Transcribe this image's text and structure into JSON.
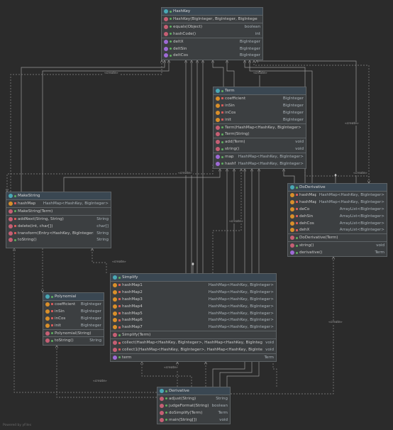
{
  "diagram": {
    "classes": [
      {
        "key": "hashkey",
        "name": "HashKey",
        "sections": [
          [
            {
              "icon": "method",
              "vis": "public",
              "name": "HashKey(BigInteger, BigInteger, BigInteger)",
              "type": ""
            }
          ],
          [
            {
              "icon": "method",
              "vis": "public",
              "name": "equals(Object)",
              "type": "boolean"
            },
            {
              "icon": "method",
              "vis": "public",
              "name": "hashCode()",
              "type": "int"
            }
          ],
          [
            {
              "icon": "property",
              "vis": "public",
              "name": "deltX",
              "type": "BigInteger"
            },
            {
              "icon": "property",
              "vis": "public",
              "name": "deltSin",
              "type": "BigInteger"
            },
            {
              "icon": "property",
              "vis": "public",
              "name": "deltCos",
              "type": "BigInteger"
            }
          ]
        ]
      },
      {
        "key": "term",
        "name": "Term",
        "sections": [
          [
            {
              "icon": "field",
              "vis": "private",
              "name": "coefficient",
              "type": "BigInteger"
            },
            {
              "icon": "field",
              "vis": "private",
              "name": "inSin",
              "type": "BigInteger"
            },
            {
              "icon": "field",
              "vis": "private",
              "name": "inCos",
              "type": "BigInteger"
            },
            {
              "icon": "field",
              "vis": "private",
              "name": "init",
              "type": "BigInteger"
            }
          ],
          [
            {
              "icon": "method",
              "vis": "public",
              "name": "Term(HashMap<HashKey, BigInteger>)",
              "type": ""
            },
            {
              "icon": "method",
              "vis": "public",
              "name": "Term(String)",
              "type": ""
            }
          ],
          [
            {
              "icon": "method",
              "vis": "public",
              "name": "add(Term)",
              "type": "void"
            },
            {
              "icon": "method",
              "vis": "public",
              "name": "string()",
              "type": "void"
            }
          ],
          [
            {
              "icon": "property",
              "vis": "public",
              "name": "map",
              "type": "HashMap<HashKey, BigInteger>"
            },
            {
              "icon": "property",
              "vis": "public",
              "name": "hashMap",
              "type": "HashMap<HashKey, BigInteger>"
            }
          ]
        ]
      },
      {
        "key": "makestring",
        "name": "MakeString",
        "sections": [
          [
            {
              "icon": "field",
              "vis": "private",
              "name": "hashMap",
              "type": "HashMap<HashKey, BigInteger>"
            }
          ],
          [
            {
              "icon": "method",
              "vis": "public",
              "name": "MakeString(Term)",
              "type": ""
            }
          ],
          [
            {
              "icon": "method",
              "vis": "private",
              "name": "addNext(String, String)",
              "type": "String"
            },
            {
              "icon": "method",
              "vis": "private",
              "name": "delete(int, char[])",
              "type": "char[]"
            },
            {
              "icon": "method",
              "vis": "private",
              "name": "transform(Entry<HashKey, BigInteger>)",
              "type": "String"
            },
            {
              "icon": "method",
              "vis": "public",
              "name": "toString()",
              "type": "String"
            }
          ]
        ]
      },
      {
        "key": "doderivative",
        "name": "DoDerivative",
        "sections": [
          [
            {
              "icon": "field",
              "vis": "private",
              "name": "hashMap1",
              "type": "HashMap<HashKey, BigInteger>"
            },
            {
              "icon": "field",
              "vis": "private",
              "name": "hashMap2",
              "type": "HashMap<HashKey, BigInteger>"
            },
            {
              "icon": "field",
              "vis": "private",
              "name": "deCo",
              "type": "ArrayList<BigInteger>"
            },
            {
              "icon": "field",
              "vis": "private",
              "name": "dehSin",
              "type": "ArrayList<BigInteger>"
            },
            {
              "icon": "field",
              "vis": "private",
              "name": "dehCos",
              "type": "ArrayList<BigInteger>"
            },
            {
              "icon": "field",
              "vis": "private",
              "name": "dehX",
              "type": "ArrayList<BigInteger>"
            }
          ],
          [
            {
              "icon": "method",
              "vis": "public",
              "name": "DoDerivative(Term)",
              "type": ""
            }
          ],
          [
            {
              "icon": "method",
              "vis": "public",
              "name": "string()",
              "type": "void"
            },
            {
              "icon": "property",
              "vis": "public",
              "name": "derivative()",
              "type": "Term"
            }
          ]
        ]
      },
      {
        "key": "simplify",
        "name": "Simplify",
        "sections": [
          [
            {
              "icon": "field",
              "vis": "private",
              "name": "hashMap1",
              "type": "HashMap<HashKey, BigInteger>"
            },
            {
              "icon": "field",
              "vis": "private",
              "name": "hashMap2",
              "type": "HashMap<HashKey, BigInteger>"
            },
            {
              "icon": "field",
              "vis": "private",
              "name": "hashMap3",
              "type": "HashMap<HashKey, BigInteger>"
            },
            {
              "icon": "field",
              "vis": "private",
              "name": "hashMap4",
              "type": "HashMap<HashKey, BigInteger>"
            },
            {
              "icon": "field",
              "vis": "private",
              "name": "hashMap5",
              "type": "HashMap<HashKey, BigInteger>"
            },
            {
              "icon": "field",
              "vis": "private",
              "name": "hashMap6",
              "type": "HashMap<HashKey, BigInteger>"
            },
            {
              "icon": "field",
              "vis": "private",
              "name": "hashMap7",
              "type": "HashMap<HashKey, BigInteger>"
            }
          ],
          [
            {
              "icon": "method",
              "vis": "public",
              "name": "Simplify(Term)",
              "type": ""
            }
          ],
          [
            {
              "icon": "method",
              "vis": "private",
              "name": "collect(HashMap<HashKey, BigInteger>, HashMap<HashKey, BigInteger>)",
              "type": "void"
            },
            {
              "icon": "method",
              "vis": "private",
              "name": "collect1(HashMap<HashKey, BigInteger>, HashMap<HashKey, BigInteger>)",
              "type": "void"
            }
          ],
          [
            {
              "icon": "property",
              "vis": "public",
              "name": "term",
              "type": "Term"
            }
          ]
        ]
      },
      {
        "key": "polynomial",
        "name": "Polynomial",
        "sections": [
          [
            {
              "icon": "field",
              "vis": "private",
              "name": "coefficient",
              "type": "BigInteger"
            },
            {
              "icon": "field",
              "vis": "private",
              "name": "inSin",
              "type": "BigInteger"
            },
            {
              "icon": "field",
              "vis": "private",
              "name": "inCos",
              "type": "BigInteger"
            },
            {
              "icon": "field",
              "vis": "private",
              "name": "init",
              "type": "BigInteger"
            }
          ],
          [
            {
              "icon": "method",
              "vis": "public",
              "name": "Polynomial(String)",
              "type": ""
            }
          ],
          [
            {
              "icon": "method",
              "vis": "public",
              "name": "toString()",
              "type": "String"
            }
          ]
        ]
      },
      {
        "key": "derivative",
        "name": "Derivative",
        "sections": [
          [
            {
              "icon": "method",
              "vis": "public",
              "name": "adjust(String)",
              "type": "String"
            },
            {
              "icon": "method",
              "vis": "public",
              "name": "judgeFormat(String)",
              "type": "boolean"
            },
            {
              "icon": "method",
              "vis": "public",
              "name": "doSimplify(Term)",
              "type": "Term"
            },
            {
              "icon": "method",
              "vis": "public",
              "name": "main(String[])",
              "type": "void"
            }
          ]
        ]
      }
    ],
    "edge_label": "«create»",
    "footer": "Powered by yFiles"
  },
  "colors": {
    "background": "#2b2b2b",
    "edge": "#9a9a9a",
    "dashed_edge": "#8a8a8a"
  }
}
